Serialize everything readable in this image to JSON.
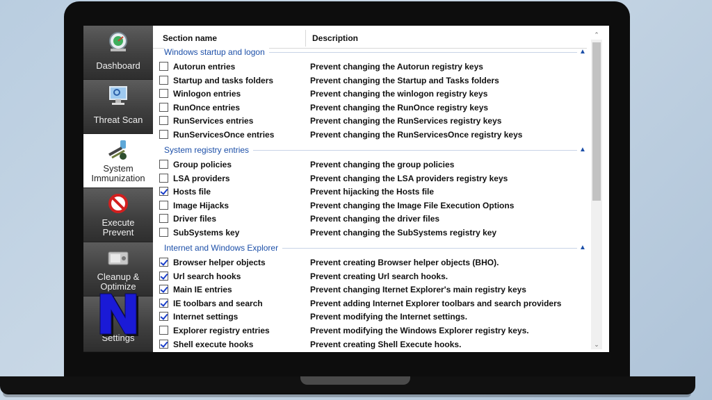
{
  "sidebar": {
    "items": [
      {
        "label_1": "Dashboard",
        "label_2": "",
        "icon": "dashboard-icon"
      },
      {
        "label_1": "Threat Scan",
        "label_2": "",
        "icon": "threat-scan-icon"
      },
      {
        "label_1": "System",
        "label_2": "Immunization",
        "icon": "syringe-icon",
        "active": true
      },
      {
        "label_1": "Execute",
        "label_2": "Prevent",
        "icon": "no-entry-icon"
      },
      {
        "label_1": "Cleanup &",
        "label_2": "Optimize",
        "icon": "cleanup-icon"
      },
      {
        "label_1": "Settings",
        "label_2": "",
        "icon": "settings-icon"
      }
    ],
    "overlay_logo": "N"
  },
  "table": {
    "col_section": "Section name",
    "col_description": "Description"
  },
  "sections": [
    {
      "title": "Windows startup and logon",
      "rows": [
        {
          "name": "Autorun entries",
          "desc": "Prevent changing the Autorun registry keys",
          "checked": false
        },
        {
          "name": "Startup and tasks folders",
          "desc": "Prevent changing the Startup and Tasks folders",
          "checked": false
        },
        {
          "name": "Winlogon entries",
          "desc": "Prevent changing the winlogon registry keys",
          "checked": false
        },
        {
          "name": "RunOnce entries",
          "desc": "Prevent changing the RunOnce registry keys",
          "checked": false
        },
        {
          "name": "RunServices entries",
          "desc": "Prevent changing the RunServices registry keys",
          "checked": false
        },
        {
          "name": "RunServicesOnce entries",
          "desc": "Prevent changing the RunServicesOnce registry keys",
          "checked": false
        }
      ]
    },
    {
      "title": "System registry entries",
      "rows": [
        {
          "name": "Group policies",
          "desc": "Prevent changing the group policies",
          "checked": false
        },
        {
          "name": "LSA providers",
          "desc": "Prevent changing the LSA providers registry keys",
          "checked": false
        },
        {
          "name": "Hosts file",
          "desc": "Prevent hijacking the Hosts file",
          "checked": true
        },
        {
          "name": "Image Hijacks",
          "desc": "Prevent changing the Image  File Execution Options",
          "checked": false
        },
        {
          "name": "Driver files",
          "desc": "Prevent changing the driver files",
          "checked": false
        },
        {
          "name": "SubSystems key",
          "desc": "Prevent changing the SubSystems registry key",
          "checked": false
        }
      ]
    },
    {
      "title": "Internet and Windows Explorer",
      "rows": [
        {
          "name": "Browser helper objects",
          "desc": "Prevent creating Browser helper objects (BHO).",
          "checked": true
        },
        {
          "name": "Url search hooks",
          "desc": "Prevent creating Url search hooks.",
          "checked": true
        },
        {
          "name": "Main IE entries",
          "desc": "Prevent changing Iternet Explorer's main registry keys",
          "checked": true
        },
        {
          "name": "IE toolbars and search",
          "desc": "Prevent adding Internet Explorer toolbars and search providers",
          "checked": true
        },
        {
          "name": "Internet settings",
          "desc": "Prevent modifying the Internet settings.",
          "checked": true
        },
        {
          "name": "Explorer registry entries",
          "desc": "Prevent modifying the Windows Explorer registry keys.",
          "checked": false
        },
        {
          "name": "Shell execute hooks",
          "desc": "Prevent creating Shell Execute hooks.",
          "checked": true
        }
      ]
    }
  ],
  "colors": {
    "section_title": "#1c4fa8",
    "checkmark": "#1a3ec9",
    "logo_fill": "#1a1ad6"
  }
}
